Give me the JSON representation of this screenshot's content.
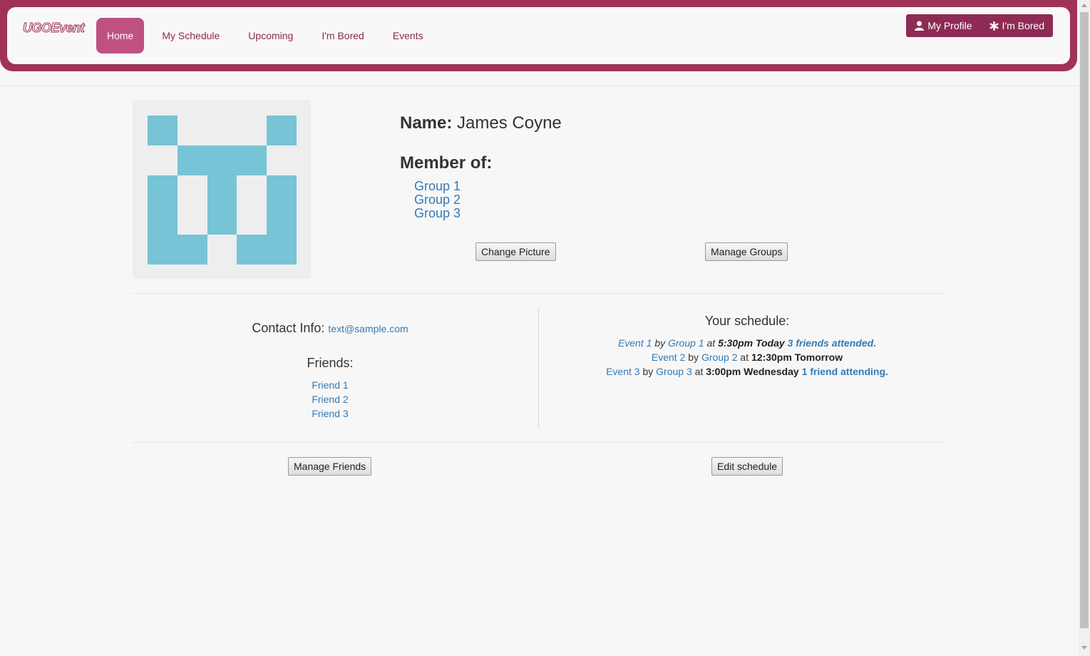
{
  "nav": {
    "brand": "UGOEvent",
    "items": [
      {
        "label": "Home",
        "active": true
      },
      {
        "label": "My Schedule",
        "active": false
      },
      {
        "label": "Upcoming",
        "active": false
      },
      {
        "label": "I'm Bored",
        "active": false
      },
      {
        "label": "Events",
        "active": false
      }
    ],
    "actions": [
      {
        "label": "My Profile",
        "icon": "user-icon"
      },
      {
        "label": "I'm Bored",
        "icon": "asterisk-icon"
      }
    ]
  },
  "profile": {
    "name_label": "Name:",
    "name": "James Coyne",
    "member_label": "Member of:",
    "groups": [
      "Group 1",
      "Group 2",
      "Group 3"
    ],
    "change_picture_button": "Change Picture",
    "manage_groups_button": "Manage Groups",
    "avatar_color": "#76c4d6"
  },
  "contact": {
    "label": "Contact Info:",
    "email": "text@sample.com"
  },
  "friends": {
    "title": "Friends:",
    "list": [
      "Friend 1",
      "Friend 2",
      "Friend 3"
    ],
    "manage_button": "Manage Friends"
  },
  "schedule": {
    "title": "Your schedule:",
    "by": "by",
    "at": "at",
    "events": [
      {
        "event": "Event 1",
        "group": "Group 1",
        "time": "5:30pm Today",
        "friends": "3 friends attended."
      },
      {
        "event": "Event 2",
        "group": "Group 2",
        "time": "12:30pm Tomorrow",
        "friends": ""
      },
      {
        "event": "Event 3",
        "group": "Group 3",
        "time": "3:00pm Wednesday",
        "friends": "1 friend attending."
      }
    ],
    "edit_button": "Edit schedule"
  },
  "colors": {
    "brand": "#a0325a",
    "active_tab": "#bf5181",
    "link": "#337ab7"
  }
}
